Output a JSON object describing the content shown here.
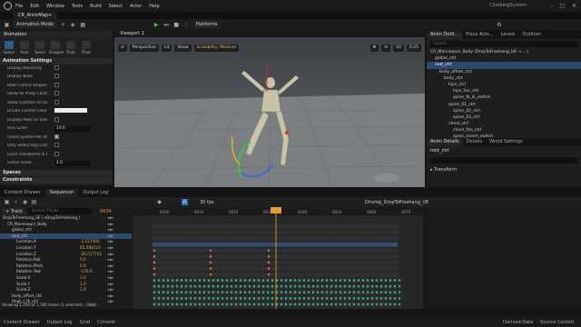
{
  "app": {
    "title": "ClimbingSystem",
    "menu": [
      "File",
      "Edit",
      "Window",
      "Tools",
      "Build",
      "Select",
      "Actor",
      "Help"
    ],
    "doc_tab": "CR_AnimMap+"
  },
  "toolbar": {
    "mode": "Animation Mode",
    "platforms": "Platforms"
  },
  "animation_panel": {
    "title": "Animation",
    "modes": [
      "Select",
      "Pose",
      "Tween",
      "Snapper",
      "Trails",
      "Pivot"
    ],
    "section": "Animation Settings",
    "props": [
      {
        "name": "Display Hierarchy",
        "type": "check",
        "on": false
      },
      {
        "name": "Display Nulls",
        "type": "check",
        "on": false
      },
      {
        "name": "Hide Control Shapes",
        "type": "check",
        "on": false
      },
      {
        "name": "Show All Proxy Controls",
        "type": "check",
        "on": false
      },
      {
        "name": "Show Controls as Overlay",
        "type": "check",
        "on": false
      },
      {
        "name": "Driven Control Color",
        "type": "color"
      },
      {
        "name": "Display Axes on Selection",
        "type": "check",
        "on": false
      },
      {
        "name": "Axis Scale",
        "type": "num",
        "value": "10.0"
      },
      {
        "name": "Coord System Per Widget Mode",
        "type": "check",
        "on": true
      },
      {
        "name": "Only Select Rig Controls",
        "type": "check",
        "on": false
      },
      {
        "name": "Local Transforms in Each Local Space",
        "type": "check",
        "on": false
      },
      {
        "name": "Gizmo Scale",
        "type": "num",
        "value": "1.0"
      }
    ],
    "collapsed": [
      "Spaces",
      "Constraints"
    ]
  },
  "viewport": {
    "tab": "Viewport 1",
    "buttons": [
      "Perspective",
      "Lit",
      "Show",
      "Scalability: Medium"
    ],
    "right_value": "10",
    "zoom_value": "0.25"
  },
  "outliner": {
    "tabs": [
      "Anim Outli...",
      "Place Acto...",
      "Levels",
      "Outliner"
    ],
    "search": "Search",
    "rows": [
      {
        "label": "CR_Mannequin_Body (DropToFreehang_UE → ...)",
        "indent": 0,
        "sel": false
      },
      {
        "label": "global_ctrl",
        "indent": 1,
        "sel": false
      },
      {
        "label": "root_ctrl",
        "indent": 1,
        "sel": true
      },
      {
        "label": "body_offset_ctrl",
        "indent": 2,
        "sel": false
      },
      {
        "label": "body_ctrl",
        "indent": 3,
        "sel": false
      },
      {
        "label": "hips_ctrl",
        "indent": 4,
        "sel": false
      },
      {
        "label": "hips_fan_ctrl",
        "indent": 5,
        "sel": false
      },
      {
        "label": "spine_fk_ik_switch",
        "indent": 5,
        "sel": false
      },
      {
        "label": "spine_01_ctrl",
        "indent": 4,
        "sel": false
      },
      {
        "label": "spine_02_ctrl",
        "indent": 5,
        "sel": false
      },
      {
        "label": "spine_03_ctrl",
        "indent": 5,
        "sel": false
      },
      {
        "label": "chest_ctrl",
        "indent": 4,
        "sel": false
      },
      {
        "label": "chest_fan_ctrl",
        "indent": 5,
        "sel": false
      },
      {
        "label": "spine_invert_switch",
        "indent": 5,
        "sel": false
      }
    ]
  },
  "details": {
    "tabs": [
      "Anim Details",
      "Details",
      "World Settings"
    ],
    "item": "root_ctrl",
    "section": "Transform"
  },
  "sequencer": {
    "tabs": [
      "Content Drawer",
      "Sequencer",
      "Output Log"
    ],
    "fps": "30 fps",
    "sequence_name": "Driving_DropToFreehang_UE",
    "frame_current": "0034",
    "time_markers": [
      "0000",
      "0010",
      "0020",
      "0030",
      "0040",
      "0050",
      "0060",
      "0070",
      "0080"
    ],
    "add_track": "+ Track",
    "search_placeholder": "Search Tracks",
    "tracks": [
      {
        "name": "DropToFreehang_UE (→DropToFreehang_UE)",
        "val": "",
        "lvl": 0
      },
      {
        "name": "CR_Mannequin_Body",
        "val": "",
        "lvl": 1
      },
      {
        "name": "global_ctrl",
        "val": "",
        "lvl": 2
      },
      {
        "name": "root_ctrl",
        "val": "",
        "lvl": 2,
        "sel": true
      },
      {
        "name": "Location.X",
        "val": "-2.527400",
        "lvl": 3
      },
      {
        "name": "Location.Y",
        "val": "85.584423",
        "lvl": 3
      },
      {
        "name": "Location.Z",
        "val": "-26.017702",
        "lvl": 3
      },
      {
        "name": "Rotation.Roll",
        "val": "0.0",
        "lvl": 3
      },
      {
        "name": "Rotation.Pitch",
        "val": "0.0",
        "lvl": 3
      },
      {
        "name": "Rotation.Yaw",
        "val": "-170.0",
        "lvl": 3
      },
      {
        "name": "Scale.X",
        "val": "1.0",
        "lvl": 3
      },
      {
        "name": "Scale.Y",
        "val": "1.0",
        "lvl": 3
      },
      {
        "name": "Scale.Z",
        "val": "1.0",
        "lvl": 3
      },
      {
        "name": "body_offset_ctrl",
        "val": "",
        "lvl": 2
      },
      {
        "name": "thigh_l_fk_ctrl",
        "val": "",
        "lvl": 2
      }
    ],
    "status": "Showing 1,356 of 1,166 items (1 selected)",
    "status_btn": "clear",
    "range_start": "-0020",
    "range_end": "0120",
    "range_end2": "0100"
  },
  "bottombar": {
    "items": [
      "Content Drawer",
      "Output Log",
      "Cmd",
      "Console"
    ],
    "right": [
      "Derived Data",
      "Source Control"
    ]
  }
}
